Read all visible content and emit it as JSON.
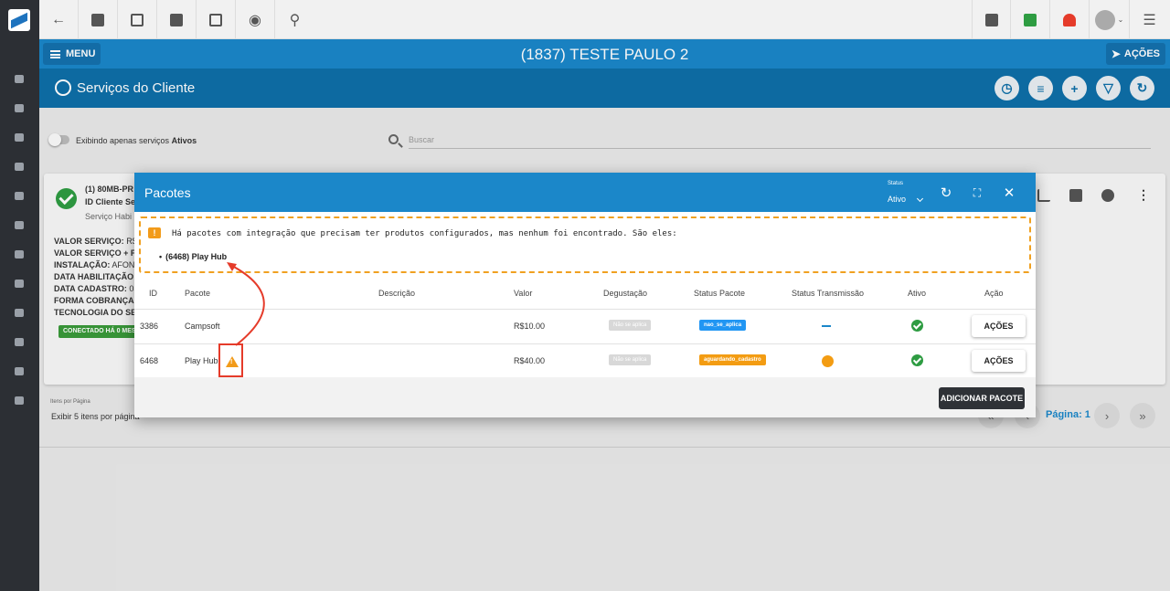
{
  "header": {
    "menu_label": "MENU",
    "client_title": "(1837) TESTE PAULO 2",
    "actions_label": "AÇÕES"
  },
  "subheader": {
    "title": "Serviços do Cliente"
  },
  "filters": {
    "toggle_label": "Exibindo apenas serviços",
    "toggle_value": "Ativos",
    "search_placeholder": "Buscar"
  },
  "service_card": {
    "title": "(1) 80MB-PR",
    "id_line": "ID Cliente Se",
    "status_line": "Serviço Habi",
    "fields": [
      {
        "label": "VALOR SERVIÇO:",
        "value": "R$1"
      },
      {
        "label": "VALOR SERVIÇO + PA",
        "value": ""
      },
      {
        "label": "INSTALAÇÃO:",
        "value": "AFONS"
      },
      {
        "label": "DATA HABILITAÇÃO:",
        "value": ""
      },
      {
        "label": "DATA CADASTRO:",
        "value": "05"
      },
      {
        "label": "FORMA COBRANÇA:",
        "value": ""
      },
      {
        "label": "TECNOLOGIA DO SER",
        "value": ""
      }
    ],
    "connection_badge": "CONECTADO HÁ 0 MESE",
    "partial_text": ")"
  },
  "pagination": {
    "items_label": "Itens por Página",
    "items_select": "Exibir 5 itens por página",
    "page_label": "Página: 1"
  },
  "modal": {
    "title": "Pacotes",
    "status_label": "Status",
    "status_value": "Ativo",
    "warning_message": "Há pacotes com integração que precisam ter produtos configurados, mas nenhum foi encontrado. São eles:",
    "warning_items": [
      "(6468) Play Hub"
    ],
    "columns": [
      "ID",
      "Pacote",
      "Descrição",
      "Valor",
      "Degustação",
      "Status Pacote",
      "Status Transmissão",
      "Ativo",
      "Ação"
    ],
    "rows": [
      {
        "id": "3386",
        "pacote": "Campsoft",
        "descricao": "",
        "valor": "R$10.00",
        "degustacao": "Não se aplica",
        "status_pacote": "nao_se_aplica",
        "acao": "AÇÕES"
      },
      {
        "id": "6468",
        "pacote": "Play Hub",
        "descricao": "",
        "valor": "R$40.00",
        "degustacao": "Não se aplica",
        "status_pacote": "aguardando_cadastro",
        "acao": "AÇÕES"
      }
    ],
    "add_button": "ADICIONAR PACOTE"
  },
  "colors": {
    "primary": "#1b87c9",
    "dark_primary": "#0e6fa8",
    "warning": "#f39c12",
    "success": "#2e9c42",
    "annotation": "#e53b2a"
  }
}
